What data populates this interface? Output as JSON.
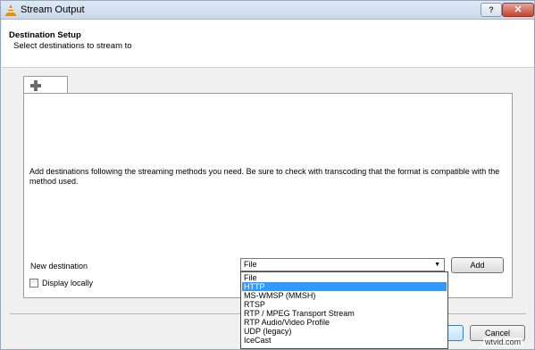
{
  "window": {
    "title": "Stream Output",
    "help_label": "?",
    "close_label": "✕"
  },
  "header": {
    "title": "Destination Setup",
    "subtitle": "Select destinations to stream to"
  },
  "tabs": {
    "add_icon": "plus-icon"
  },
  "panel": {
    "description": "Add destinations following the streaming methods you need. Be sure to check with transcoding that the format is compatible with the method used.",
    "new_destination_label": "New destination",
    "destination_value": "File",
    "add_button": "Add",
    "display_locally_label": "Display locally",
    "display_locally_checked": false
  },
  "dropdown": {
    "options": [
      "File",
      "HTTP",
      "MS-WMSP (MMSH)",
      "RTSP",
      "RTP / MPEG Transport Stream",
      "RTP Audio/Video Profile",
      "UDP (legacy)",
      "IceCast"
    ],
    "highlighted": "HTTP"
  },
  "footer": {
    "cancel_button": "Cancel"
  },
  "watermark": "wtvid.com",
  "colors": {
    "selection": "#3399ff",
    "close_button": "#c7432f",
    "title_bar": "#c9d8ea"
  }
}
